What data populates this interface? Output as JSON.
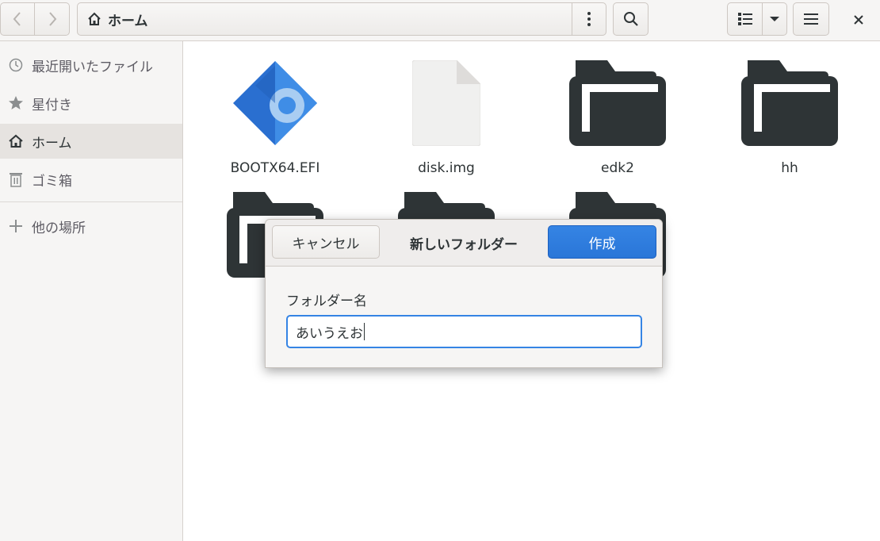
{
  "header": {
    "path_label": "ホーム",
    "icons": {
      "back": "chevron-left-icon",
      "forward": "chevron-right-icon",
      "home": "home-icon",
      "path_menu": "vertical-dots-icon",
      "search": "search-icon",
      "list_view": "list-view-icon",
      "view_options": "chevron-down-icon",
      "menu": "hamburger-menu-icon",
      "close": "close-icon"
    }
  },
  "sidebar": {
    "items": [
      {
        "label": "最近開いたファイル",
        "icon": "clock-icon"
      },
      {
        "label": "星付き",
        "icon": "star-icon"
      },
      {
        "label": "ホーム",
        "icon": "home-icon",
        "active": true
      },
      {
        "label": "ゴミ箱",
        "icon": "trash-icon"
      },
      {
        "label": "他の場所",
        "icon": "plus-icon"
      }
    ]
  },
  "files": [
    {
      "name": "BOOTX64.EFI",
      "icon": "efi-executable-icon"
    },
    {
      "name": "disk.img",
      "icon": "generic-file-icon"
    },
    {
      "name": "edk2",
      "icon": "folder-icon"
    },
    {
      "name": "hh",
      "icon": "folder-icon"
    },
    {
      "name": "",
      "icon": "folder-icon"
    },
    {
      "name": "",
      "icon": "folder-icon"
    },
    {
      "name": "",
      "icon": "folder-icon"
    }
  ],
  "dialog": {
    "title": "新しいフォルダー",
    "cancel_label": "キャンセル",
    "create_label": "作成",
    "field_label": "フォルダー名",
    "field_value": "あいうえお"
  },
  "colors": {
    "accent": "#3584e4",
    "folder": "#2e3436",
    "sidebar_bg": "#f6f5f4"
  }
}
